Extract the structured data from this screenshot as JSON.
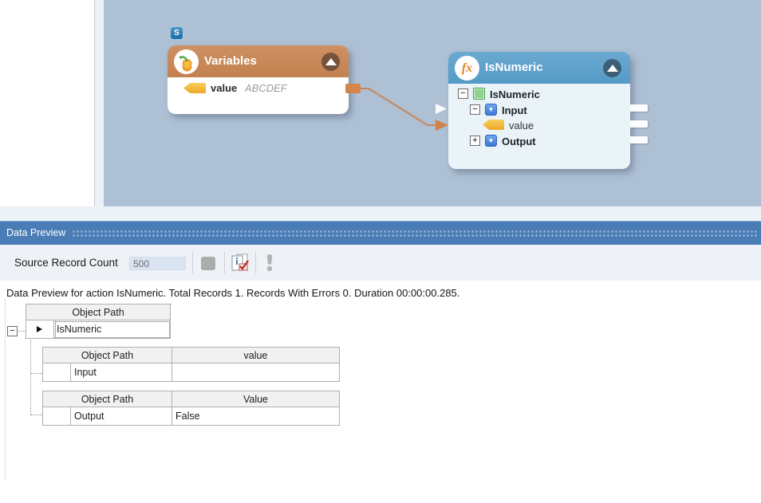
{
  "canvas": {
    "step_badge": "S",
    "variables_node": {
      "title": "Variables",
      "field": {
        "name": "value",
        "value": "ABCDEF"
      }
    },
    "isnumeric_node": {
      "title": "IsNumeric",
      "rows": [
        {
          "label": "IsNumeric"
        },
        {
          "label": "Input"
        },
        {
          "label": "value"
        },
        {
          "label": "Output"
        }
      ]
    }
  },
  "data_preview": {
    "panel_title": "Data Preview",
    "toolbar": {
      "source_record_count_label": "Source Record Count",
      "source_record_count_value": "500"
    },
    "status_text": "Data Preview for action IsNumeric. Total Records 1. Records With Errors 0. Duration 00:00:00.285.",
    "root_table": {
      "header": "Object Path",
      "row_label": "IsNumeric"
    },
    "input_table": {
      "headers": [
        "Object Path",
        "value"
      ],
      "row": {
        "path": "Input",
        "value": ""
      }
    },
    "output_table": {
      "headers": [
        "Object Path",
        "Value"
      ],
      "row": {
        "path": "Output",
        "value": "False"
      }
    }
  },
  "colors": {
    "canvas_bg": "#ADC0D4",
    "variables_header": "#C98B5E",
    "isnumeric_header": "#5FA1CA",
    "isnumeric_body": "#E9F3F8",
    "panel_bar": "#4A7CB5",
    "connector": "#C8865A",
    "accent_yellow": "#F0B93C"
  }
}
